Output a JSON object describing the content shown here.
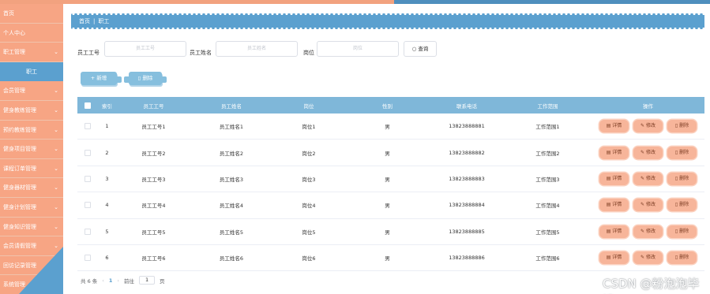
{
  "sidebar": {
    "items": [
      {
        "label": "首页",
        "chevron": false
      },
      {
        "label": "个人中心",
        "chevron": false
      },
      {
        "label": "职工管理",
        "chevron": true
      },
      {
        "label": "职工",
        "chevron": false,
        "active": true
      },
      {
        "label": "会员管理",
        "chevron": true
      },
      {
        "label": "健身教练管理",
        "chevron": true
      },
      {
        "label": "预约教练管理",
        "chevron": true
      },
      {
        "label": "健身项目管理",
        "chevron": true
      },
      {
        "label": "课程订单管理",
        "chevron": true
      },
      {
        "label": "健身器材管理",
        "chevron": true
      },
      {
        "label": "健身计划管理",
        "chevron": true
      },
      {
        "label": "健身知识管理",
        "chevron": true
      },
      {
        "label": "会员请假管理",
        "chevron": true
      },
      {
        "label": "回访记录管理",
        "chevron": true
      },
      {
        "label": "系统管理",
        "chevron": true
      }
    ],
    "chevron_glyph": "⌄"
  },
  "breadcrumb": {
    "home": "首页",
    "sep": "|",
    "current": "职工"
  },
  "search": {
    "field1": {
      "label": "员工工号",
      "placeholder": "员工工号"
    },
    "field2": {
      "label": "员工姓名",
      "placeholder": "员工姓名"
    },
    "field3": {
      "label": "岗位",
      "placeholder": "岗位"
    },
    "query_label": "查询"
  },
  "actions": {
    "add_label": "+ 新增",
    "delete_label": "删除"
  },
  "table": {
    "headers": {
      "index": "索引",
      "no": "员工工号",
      "name": "员工姓名",
      "pos": "岗位",
      "sex": "性别",
      "tel": "联系电话",
      "scope": "工作范围",
      "op": "操作"
    },
    "rows": [
      {
        "index": "1",
        "no": "员工工号1",
        "name": "员工姓名1",
        "pos": "岗位1",
        "sex": "男",
        "tel": "13823888881",
        "scope": "工作范围1"
      },
      {
        "index": "2",
        "no": "员工工号2",
        "name": "员工姓名2",
        "pos": "岗位2",
        "sex": "男",
        "tel": "13823888882",
        "scope": "工作范围2"
      },
      {
        "index": "3",
        "no": "员工工号3",
        "name": "员工姓名3",
        "pos": "岗位3",
        "sex": "男",
        "tel": "13823888883",
        "scope": "工作范围3"
      },
      {
        "index": "4",
        "no": "员工工号4",
        "name": "员工姓名4",
        "pos": "岗位4",
        "sex": "男",
        "tel": "13823888884",
        "scope": "工作范围4"
      },
      {
        "index": "5",
        "no": "员工工号5",
        "name": "员工姓名5",
        "pos": "岗位5",
        "sex": "男",
        "tel": "13823888885",
        "scope": "工作范围5"
      },
      {
        "index": "6",
        "no": "员工工号6",
        "name": "员工姓名6",
        "pos": "岗位6",
        "sex": "男",
        "tel": "13823888886",
        "scope": "工作范围6"
      }
    ],
    "op_labels": {
      "detail": "详情",
      "edit": "修改",
      "delete": "删除"
    }
  },
  "pagination": {
    "total": "共 6 条",
    "prev": "‹",
    "current": "1",
    "next": "›",
    "goto": "前往",
    "page_value": "1",
    "page_unit": "页"
  },
  "watermark": "CSDN @粉泡泡毕设",
  "colors": {
    "sidebar": "#f7a584",
    "accent": "#5ba0cf",
    "table_header": "#7fb7d9",
    "op_button": "#f7b59a"
  }
}
